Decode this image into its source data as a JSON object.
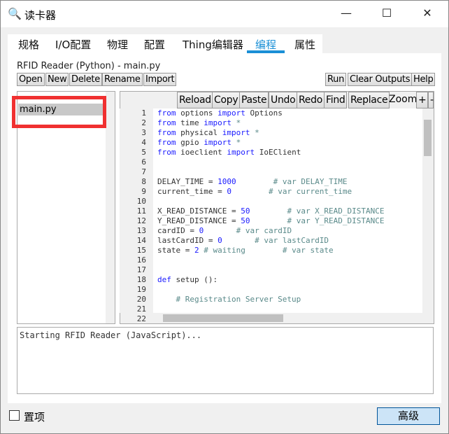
{
  "window": {
    "title": "读卡器",
    "minimize": "—",
    "maximize": "☐",
    "close": "✕"
  },
  "tabs": [
    {
      "label": "规格"
    },
    {
      "label": "I/O配置"
    },
    {
      "label": "物理"
    },
    {
      "label": "配置"
    },
    {
      "label": "Thing编辑器"
    },
    {
      "label": "编程",
      "active": true
    },
    {
      "label": "属性"
    }
  ],
  "program": {
    "title": "RFID Reader (Python) - main.py",
    "file_buttons": [
      "Open",
      "New",
      "Delete",
      "Rename",
      "Import"
    ],
    "run_buttons": [
      "Run",
      "Clear Outputs",
      "Help"
    ],
    "files": [
      "main.py"
    ],
    "files_parent": "..",
    "editor_buttons": [
      "Reload",
      "Copy",
      "Paste",
      "Undo",
      "Redo",
      "Find",
      "Replace"
    ],
    "zoom_label": "Zoom:",
    "zoom_in": "+",
    "zoom_out": "-",
    "code": [
      [
        "1",
        [
          [
            "kw",
            "from"
          ],
          [
            "",
            "options"
          ],
          [
            "kw",
            "import"
          ],
          [
            "",
            "Options"
          ]
        ]
      ],
      [
        "2",
        [
          [
            "kw",
            "from"
          ],
          [
            "",
            "time"
          ],
          [
            "kw",
            "import"
          ],
          [
            "cm",
            "*"
          ]
        ]
      ],
      [
        "3",
        [
          [
            "kw",
            "from"
          ],
          [
            "",
            "physical"
          ],
          [
            "kw",
            "import"
          ],
          [
            "cm",
            "*"
          ]
        ]
      ],
      [
        "4",
        [
          [
            "kw",
            "from"
          ],
          [
            "",
            "gpio"
          ],
          [
            "kw",
            "import"
          ],
          [
            "cm",
            "*"
          ]
        ]
      ],
      [
        "5",
        [
          [
            "kw",
            "from"
          ],
          [
            "",
            "ioeclient"
          ],
          [
            "kw",
            "import"
          ],
          [
            "",
            "IoEClient"
          ]
        ]
      ],
      [
        "6",
        []
      ],
      [
        "7",
        []
      ],
      [
        "8",
        [
          [
            "",
            "DELAY_TIME ="
          ],
          [
            "num",
            "1000"
          ],
          [
            "cm",
            "       # var DELAY_TIME"
          ]
        ]
      ],
      [
        "9",
        [
          [
            "",
            "current_time ="
          ],
          [
            "num",
            "0"
          ],
          [
            "cm",
            "       # var current_time"
          ]
        ]
      ],
      [
        "10",
        []
      ],
      [
        "11",
        [
          [
            "",
            "X_READ_DISTANCE ="
          ],
          [
            "num",
            "50"
          ],
          [
            "cm",
            "       # var X_READ_DISTANCE"
          ]
        ]
      ],
      [
        "12",
        [
          [
            "",
            "Y_READ_DISTANCE ="
          ],
          [
            "num",
            "50"
          ],
          [
            "cm",
            "       # var Y_READ_DISTANCE"
          ]
        ]
      ],
      [
        "13",
        [
          [
            "",
            "cardID ="
          ],
          [
            "num",
            "0"
          ],
          [
            "cm",
            "      # var cardID"
          ]
        ]
      ],
      [
        "14",
        [
          [
            "",
            "lastCardID ="
          ],
          [
            "num",
            "0"
          ],
          [
            "cm",
            "      # var lastCardID"
          ]
        ]
      ],
      [
        "15",
        [
          [
            "",
            "state ="
          ],
          [
            "num",
            "2"
          ],
          [
            "cm",
            "# waiting        # var state"
          ]
        ]
      ],
      [
        "16",
        []
      ],
      [
        "17",
        []
      ],
      [
        "18",
        [
          [
            "kw",
            "def"
          ],
          [
            "",
            "setup ():"
          ]
        ]
      ],
      [
        "19",
        []
      ],
      [
        "20",
        [
          [
            "cm",
            "    # Registration Server Setup"
          ]
        ]
      ],
      [
        "21",
        []
      ],
      [
        "22",
        []
      ]
    ],
    "output": "Starting RFID Reader (JavaScript)..."
  },
  "footer": {
    "pin_label": "置项",
    "pin_checked": false,
    "advanced_button": "高级"
  },
  "colors": {
    "accent": "#1a8fd6",
    "highlight_box": "#f03030"
  }
}
